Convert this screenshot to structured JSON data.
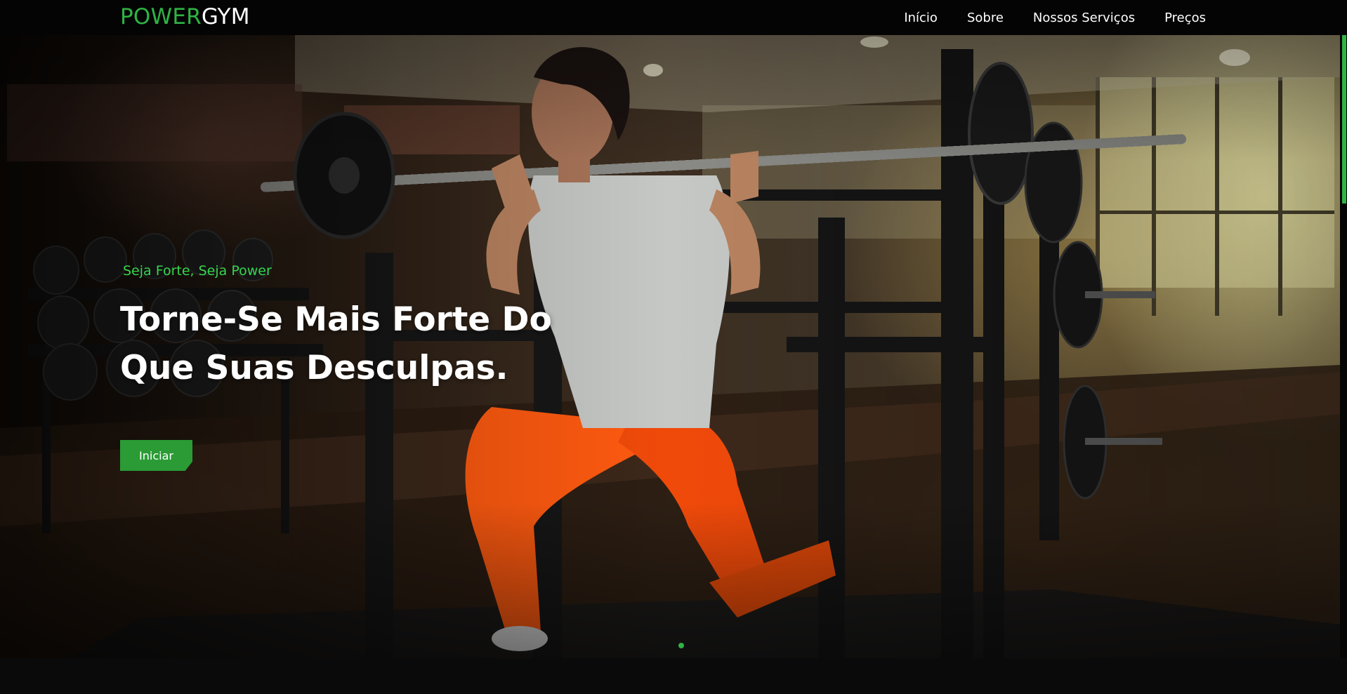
{
  "brand": {
    "name_part1": "POWER",
    "name_part2": "GYM",
    "accent_color": "#2fb344"
  },
  "nav": {
    "links": [
      {
        "label": "Início"
      },
      {
        "label": "Sobre"
      },
      {
        "label": "Nossos Serviços"
      },
      {
        "label": "Preços"
      }
    ]
  },
  "hero": {
    "tagline": "Seja Forte, Seja Power",
    "title_line1": "Torne-Se Mais Forte Do",
    "title_line2": "Que Suas Desculpas.",
    "cta_label": "Iniciar",
    "cta_color": "#2a9b35",
    "slides_total": 1,
    "slide_active": 1
  }
}
